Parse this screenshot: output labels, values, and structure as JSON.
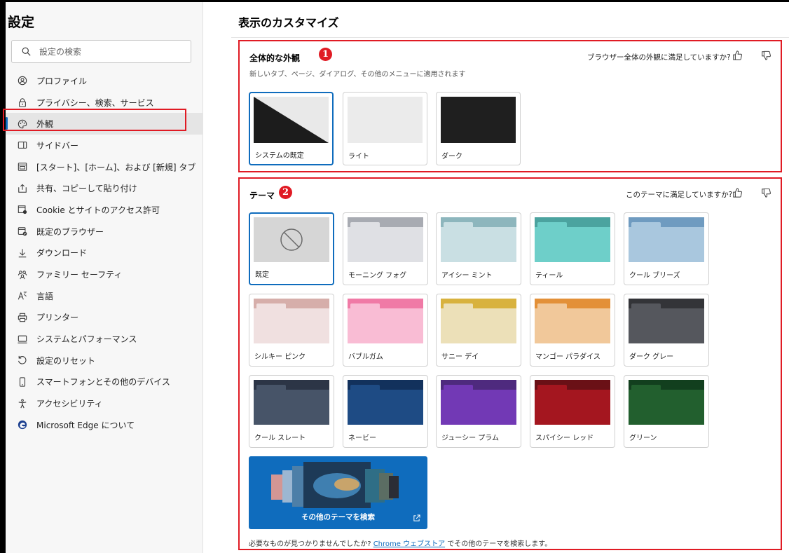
{
  "sidebar": {
    "title": "設定",
    "search_placeholder": "設定の検索",
    "items": [
      {
        "label": "プロファイル",
        "icon": "profile-icon"
      },
      {
        "label": "プライバシー、検索、サービス",
        "icon": "lock-icon"
      },
      {
        "label": "外観",
        "icon": "palette-icon",
        "active": true
      },
      {
        "label": "サイドバー",
        "icon": "sidebar-icon"
      },
      {
        "label": "[スタート]、[ホーム]、および [新規] タブ",
        "icon": "home-tab-icon"
      },
      {
        "label": "共有、コピーして貼り付け",
        "icon": "share-icon"
      },
      {
        "label": "Cookie とサイトのアクセス許可",
        "icon": "cookie-permissions-icon"
      },
      {
        "label": "既定のブラウザー",
        "icon": "default-browser-icon"
      },
      {
        "label": "ダウンロード",
        "icon": "download-icon"
      },
      {
        "label": "ファミリー セーフティ",
        "icon": "family-icon"
      },
      {
        "label": "言語",
        "icon": "language-icon"
      },
      {
        "label": "プリンター",
        "icon": "printer-icon"
      },
      {
        "label": "システムとパフォーマンス",
        "icon": "system-icon"
      },
      {
        "label": "設定のリセット",
        "icon": "reset-icon"
      },
      {
        "label": "スマートフォンとその他のデバイス",
        "icon": "phone-icon"
      },
      {
        "label": "アクセシビリティ",
        "icon": "accessibility-icon"
      },
      {
        "label": "Microsoft Edge について",
        "icon": "edge-logo-icon"
      }
    ]
  },
  "main": {
    "title": "表示のカスタマイズ",
    "appearance": {
      "badge": "1",
      "title": "全体的な外観",
      "subtitle": "新しいタブ、ページ、ダイアログ、その他のメニューに適用されます",
      "feedback_question": "ブラウザー全体の外観に満足していますか?",
      "options": [
        {
          "label": "システムの既定",
          "selected": true
        },
        {
          "label": "ライト",
          "selected": false
        },
        {
          "label": "ダーク",
          "selected": false
        }
      ]
    },
    "themes": {
      "badge": "2",
      "title": "テーマ",
      "feedback_question": "このテーマに満足していますか?",
      "items": [
        {
          "label": "既定",
          "selected": true,
          "tab": "#cfcfcf",
          "body": "#d6d6d6"
        },
        {
          "label": "モーニング フォグ",
          "tab": "#a8abb2",
          "body": "#dfe0e4"
        },
        {
          "label": "アイシー ミント",
          "tab": "#8db6bd",
          "body": "#c9dfe3"
        },
        {
          "label": "ティール",
          "tab": "#4ba39f",
          "body": "#6ecfc9"
        },
        {
          "label": "クール ブリーズ",
          "tab": "#6f9bc0",
          "body": "#a9c7de"
        },
        {
          "label": "シルキー ピンク",
          "tab": "#d6aeaa",
          "body": "#f0e0e0"
        },
        {
          "label": "バブルガム",
          "tab": "#f07aa6",
          "body": "#f9bcd4"
        },
        {
          "label": "サニー デイ",
          "tab": "#d8b23e",
          "body": "#ece0b8"
        },
        {
          "label": "マンゴー パラダイス",
          "tab": "#e39038",
          "body": "#f1c89a"
        },
        {
          "label": "ダーク グレー",
          "tab": "#333438",
          "body": "#55575d"
        },
        {
          "label": "クール スレート",
          "tab": "#2c3546",
          "body": "#475468"
        },
        {
          "label": "ネービー",
          "tab": "#12315c",
          "body": "#1e4b84"
        },
        {
          "label": "ジューシー プラム",
          "tab": "#4e2a7e",
          "body": "#7239b5"
        },
        {
          "label": "スパイシー レッド",
          "tab": "#6a1016",
          "body": "#a4161f"
        },
        {
          "label": "グリーン",
          "tab": "#123f1e",
          "body": "#225f2e"
        }
      ],
      "more_label": "その他のテーマを検索",
      "footer_prefix": "必要なものが見つかりませんでしたか? ",
      "footer_link": "Chrome ウェブストア",
      "footer_suffix": " でその他のテーマを検索します。"
    }
  }
}
